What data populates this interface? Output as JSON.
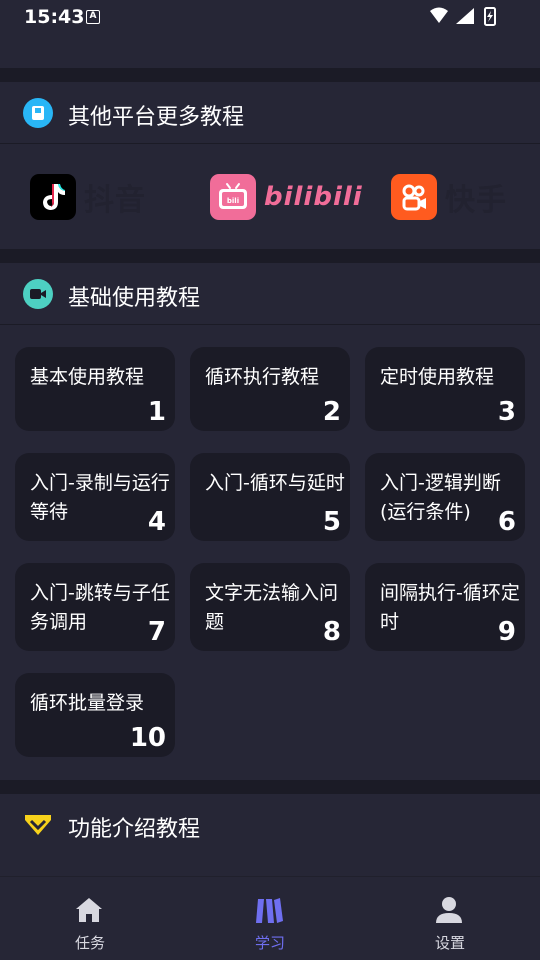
{
  "status_bar": {
    "time": "15:43",
    "a_badge": "A"
  },
  "platforms_section": {
    "title": "其他平台更多教程",
    "icon": "book-icon",
    "platforms": [
      {
        "name": "抖音",
        "icon": "douyin-logo-icon",
        "color": "#000000"
      },
      {
        "name": "bilibili",
        "icon": "bilibili-logo-icon",
        "color": "#f16d99"
      },
      {
        "name": "快手",
        "icon": "kuaishou-logo-icon",
        "color": "#ff5b1f"
      }
    ]
  },
  "basics_section": {
    "title": "基础使用教程",
    "icon": "video-camera-icon",
    "cards": [
      {
        "title": "基本使用教程",
        "num": "1"
      },
      {
        "title": "循环执行教程",
        "num": "2"
      },
      {
        "title": "定时使用教程",
        "num": "3"
      },
      {
        "title": "入门-录制与运行等待",
        "num": "4"
      },
      {
        "title": "入门-循环与延时",
        "num": "5"
      },
      {
        "title": "入门-逻辑判断(运行条件)",
        "num": "6"
      },
      {
        "title": "入门-跳转与子任务调用",
        "num": "7"
      },
      {
        "title": "文字无法输入问题",
        "num": "8"
      },
      {
        "title": "间隔执行-循环定时",
        "num": "9"
      },
      {
        "title": "循环批量登录",
        "num": "10"
      }
    ]
  },
  "features_section": {
    "title": "功能介绍教程",
    "icon": "diamond-icon"
  },
  "tabbar": {
    "tabs": [
      {
        "label": "任务",
        "icon": "home-icon",
        "active": false
      },
      {
        "label": "学习",
        "icon": "books-icon",
        "active": true
      },
      {
        "label": "设置",
        "icon": "user-icon",
        "active": false
      }
    ]
  },
  "colors": {
    "background": "#1b1b26",
    "panel": "#262636",
    "accent": "#6f6ff0",
    "book_icon": "#29b6f6",
    "camera_icon": "#4dd0c2",
    "diamond_icon": "#f7d21b"
  }
}
